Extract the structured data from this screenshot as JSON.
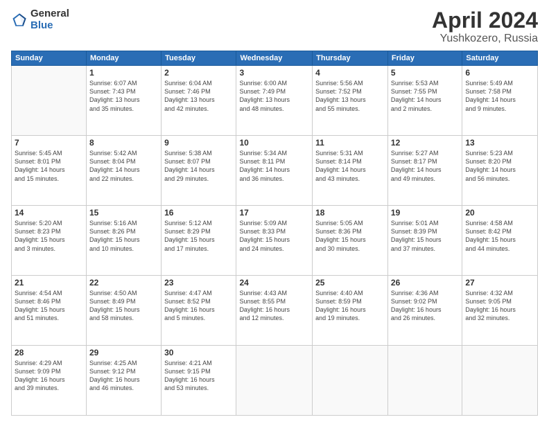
{
  "header": {
    "logo": {
      "general": "General",
      "blue": "Blue"
    },
    "title": "April 2024",
    "location": "Yushkozero, Russia"
  },
  "weekdays": [
    "Sunday",
    "Monday",
    "Tuesday",
    "Wednesday",
    "Thursday",
    "Friday",
    "Saturday"
  ],
  "weeks": [
    [
      {
        "day": "",
        "info": ""
      },
      {
        "day": "1",
        "info": "Sunrise: 6:07 AM\nSunset: 7:43 PM\nDaylight: 13 hours\nand 35 minutes."
      },
      {
        "day": "2",
        "info": "Sunrise: 6:04 AM\nSunset: 7:46 PM\nDaylight: 13 hours\nand 42 minutes."
      },
      {
        "day": "3",
        "info": "Sunrise: 6:00 AM\nSunset: 7:49 PM\nDaylight: 13 hours\nand 48 minutes."
      },
      {
        "day": "4",
        "info": "Sunrise: 5:56 AM\nSunset: 7:52 PM\nDaylight: 13 hours\nand 55 minutes."
      },
      {
        "day": "5",
        "info": "Sunrise: 5:53 AM\nSunset: 7:55 PM\nDaylight: 14 hours\nand 2 minutes."
      },
      {
        "day": "6",
        "info": "Sunrise: 5:49 AM\nSunset: 7:58 PM\nDaylight: 14 hours\nand 9 minutes."
      }
    ],
    [
      {
        "day": "7",
        "info": "Sunrise: 5:45 AM\nSunset: 8:01 PM\nDaylight: 14 hours\nand 15 minutes."
      },
      {
        "day": "8",
        "info": "Sunrise: 5:42 AM\nSunset: 8:04 PM\nDaylight: 14 hours\nand 22 minutes."
      },
      {
        "day": "9",
        "info": "Sunrise: 5:38 AM\nSunset: 8:07 PM\nDaylight: 14 hours\nand 29 minutes."
      },
      {
        "day": "10",
        "info": "Sunrise: 5:34 AM\nSunset: 8:11 PM\nDaylight: 14 hours\nand 36 minutes."
      },
      {
        "day": "11",
        "info": "Sunrise: 5:31 AM\nSunset: 8:14 PM\nDaylight: 14 hours\nand 43 minutes."
      },
      {
        "day": "12",
        "info": "Sunrise: 5:27 AM\nSunset: 8:17 PM\nDaylight: 14 hours\nand 49 minutes."
      },
      {
        "day": "13",
        "info": "Sunrise: 5:23 AM\nSunset: 8:20 PM\nDaylight: 14 hours\nand 56 minutes."
      }
    ],
    [
      {
        "day": "14",
        "info": "Sunrise: 5:20 AM\nSunset: 8:23 PM\nDaylight: 15 hours\nand 3 minutes."
      },
      {
        "day": "15",
        "info": "Sunrise: 5:16 AM\nSunset: 8:26 PM\nDaylight: 15 hours\nand 10 minutes."
      },
      {
        "day": "16",
        "info": "Sunrise: 5:12 AM\nSunset: 8:29 PM\nDaylight: 15 hours\nand 17 minutes."
      },
      {
        "day": "17",
        "info": "Sunrise: 5:09 AM\nSunset: 8:33 PM\nDaylight: 15 hours\nand 24 minutes."
      },
      {
        "day": "18",
        "info": "Sunrise: 5:05 AM\nSunset: 8:36 PM\nDaylight: 15 hours\nand 30 minutes."
      },
      {
        "day": "19",
        "info": "Sunrise: 5:01 AM\nSunset: 8:39 PM\nDaylight: 15 hours\nand 37 minutes."
      },
      {
        "day": "20",
        "info": "Sunrise: 4:58 AM\nSunset: 8:42 PM\nDaylight: 15 hours\nand 44 minutes."
      }
    ],
    [
      {
        "day": "21",
        "info": "Sunrise: 4:54 AM\nSunset: 8:46 PM\nDaylight: 15 hours\nand 51 minutes."
      },
      {
        "day": "22",
        "info": "Sunrise: 4:50 AM\nSunset: 8:49 PM\nDaylight: 15 hours\nand 58 minutes."
      },
      {
        "day": "23",
        "info": "Sunrise: 4:47 AM\nSunset: 8:52 PM\nDaylight: 16 hours\nand 5 minutes."
      },
      {
        "day": "24",
        "info": "Sunrise: 4:43 AM\nSunset: 8:55 PM\nDaylight: 16 hours\nand 12 minutes."
      },
      {
        "day": "25",
        "info": "Sunrise: 4:40 AM\nSunset: 8:59 PM\nDaylight: 16 hours\nand 19 minutes."
      },
      {
        "day": "26",
        "info": "Sunrise: 4:36 AM\nSunset: 9:02 PM\nDaylight: 16 hours\nand 26 minutes."
      },
      {
        "day": "27",
        "info": "Sunrise: 4:32 AM\nSunset: 9:05 PM\nDaylight: 16 hours\nand 32 minutes."
      }
    ],
    [
      {
        "day": "28",
        "info": "Sunrise: 4:29 AM\nSunset: 9:09 PM\nDaylight: 16 hours\nand 39 minutes."
      },
      {
        "day": "29",
        "info": "Sunrise: 4:25 AM\nSunset: 9:12 PM\nDaylight: 16 hours\nand 46 minutes."
      },
      {
        "day": "30",
        "info": "Sunrise: 4:21 AM\nSunset: 9:15 PM\nDaylight: 16 hours\nand 53 minutes."
      },
      {
        "day": "",
        "info": ""
      },
      {
        "day": "",
        "info": ""
      },
      {
        "day": "",
        "info": ""
      },
      {
        "day": "",
        "info": ""
      }
    ]
  ]
}
